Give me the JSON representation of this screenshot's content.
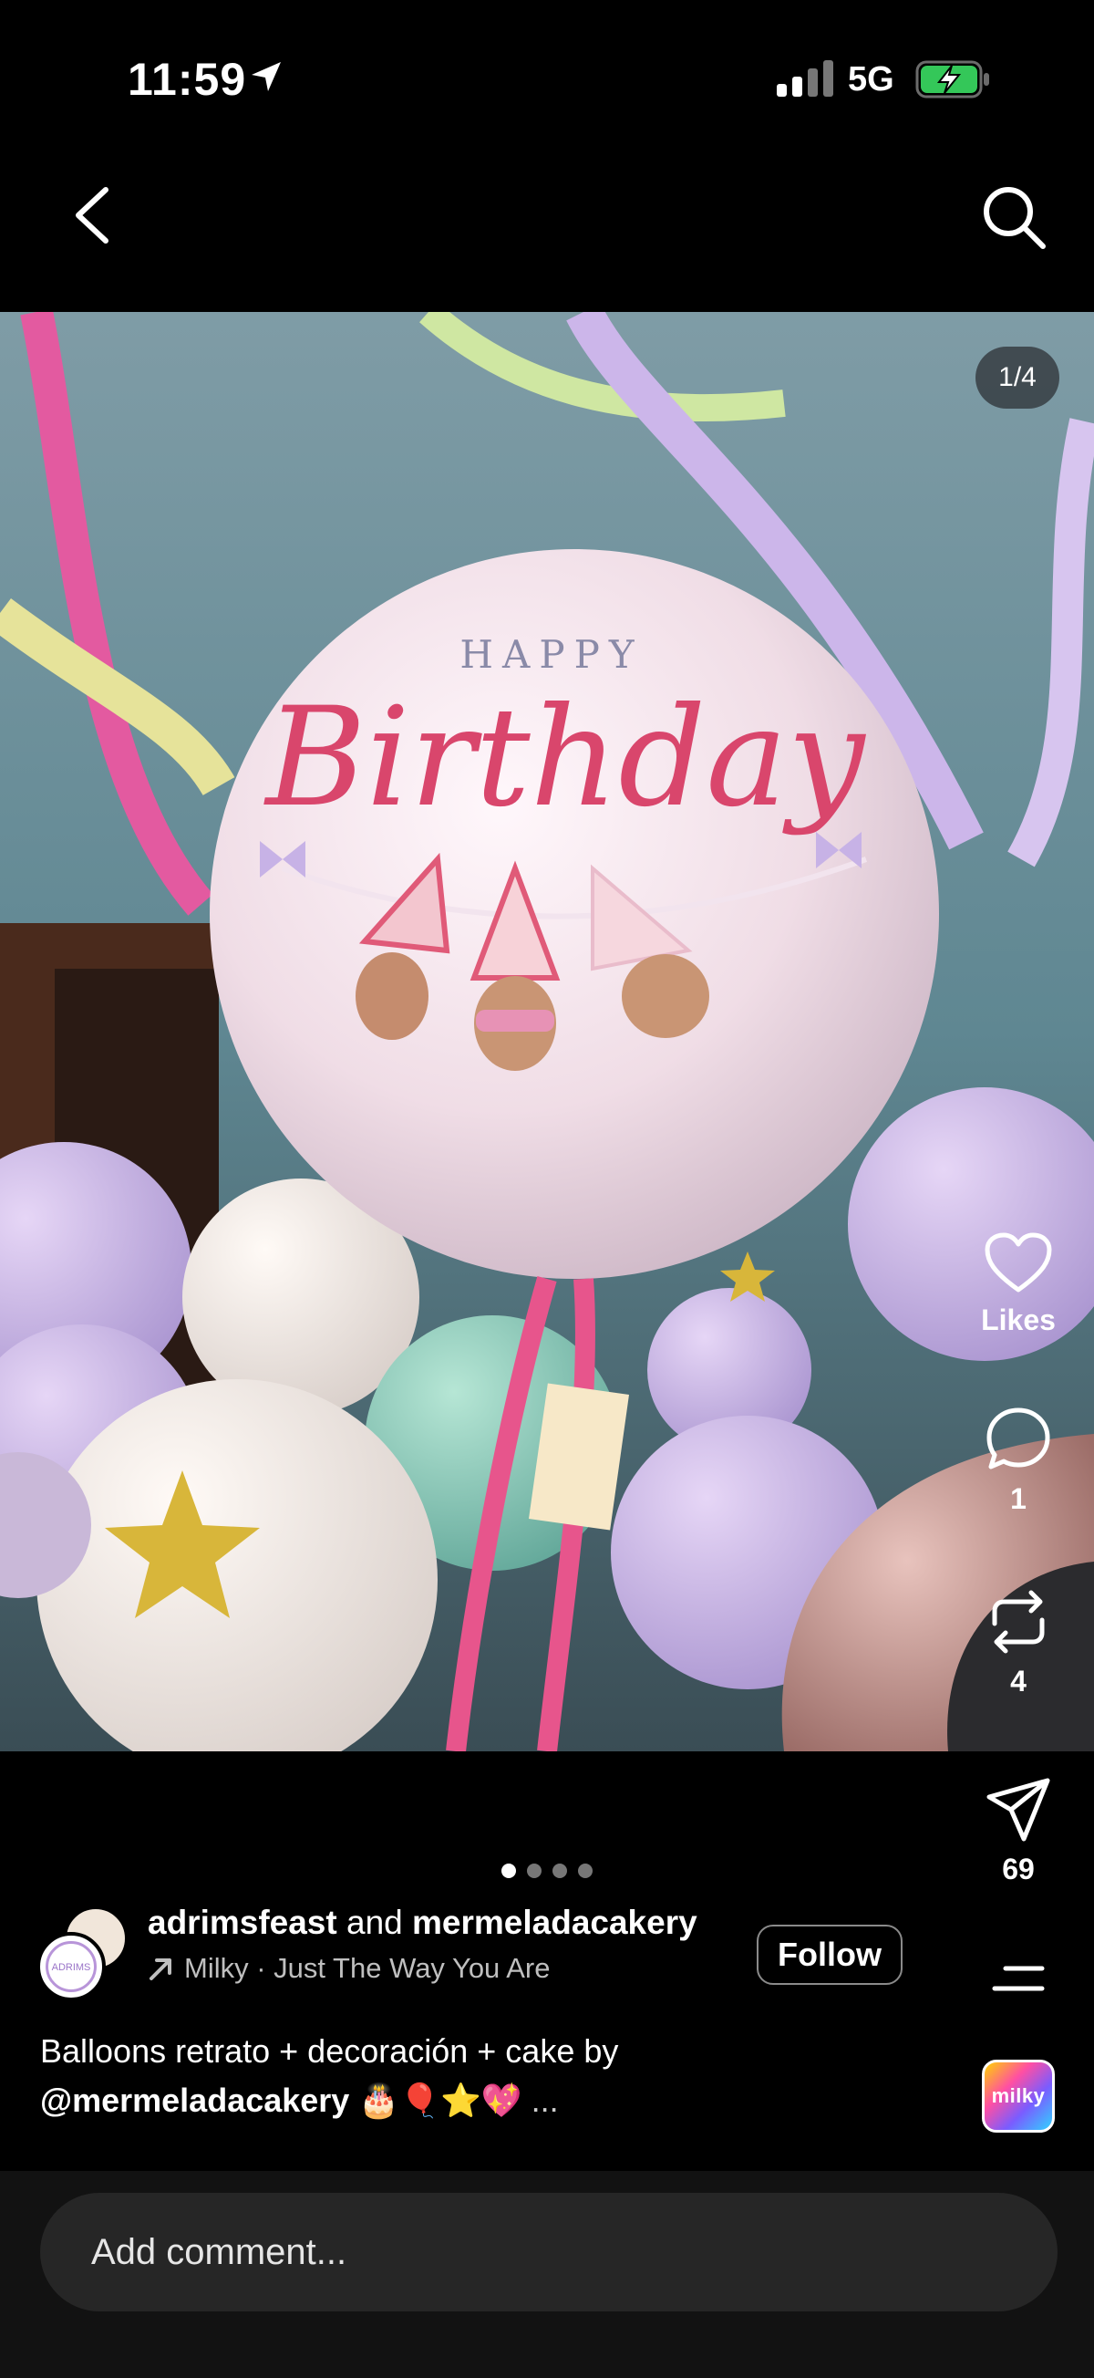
{
  "status_bar": {
    "time": "11:59",
    "network": "5G",
    "icons": [
      "location-arrow-icon",
      "signal-bars-icon",
      "battery-charging-icon"
    ]
  },
  "nav": {
    "back_icon": "chevron-left-icon",
    "search_icon": "search-icon"
  },
  "post": {
    "image_counter": "1/4",
    "photo_text": {
      "line1": "HAPPY",
      "line2": "Birthday"
    },
    "carousel": {
      "count": 4,
      "active": 0
    }
  },
  "actions": {
    "like": {
      "icon": "heart-icon",
      "label": "Likes"
    },
    "comment": {
      "icon": "comment-bubble-icon",
      "count": "1"
    },
    "repost": {
      "icon": "repost-icon",
      "count": "4"
    },
    "share": {
      "icon": "paper-plane-icon",
      "count": "69"
    },
    "more": {
      "icon": "menu-icon"
    }
  },
  "author": {
    "name1": "adrimsfeast",
    "and": " and ",
    "name2": "mermeladacakery",
    "music": "Milky · Just The Way You Are",
    "follow_label": "Follow",
    "avatar_text": "ADRIMS"
  },
  "caption": {
    "line1": "Balloons retrato + decoración + cake by",
    "mention": "@mermeladacakery",
    "emojis": "🎂🎈⭐💖",
    "more": "..."
  },
  "sticker": {
    "label": "milky"
  },
  "comment": {
    "placeholder": "Add comment..."
  }
}
